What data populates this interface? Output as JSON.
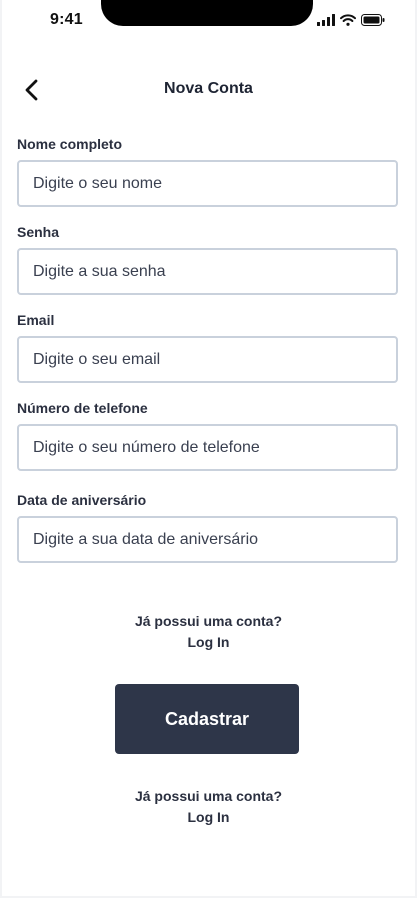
{
  "status_bar": {
    "time": "9:41",
    "icons": [
      "signal-icon",
      "wifi-icon",
      "battery-icon"
    ]
  },
  "header": {
    "back_icon": "chevron-left-icon",
    "title": "Nova Conta"
  },
  "form": {
    "fields": [
      {
        "label": "Nome completo",
        "placeholder": "Digite o seu nome",
        "value": ""
      },
      {
        "label": "Senha",
        "placeholder": "Digite a sua senha",
        "value": ""
      },
      {
        "label": "Email",
        "placeholder": "Digite o seu email",
        "value": ""
      },
      {
        "label": "Número de telefone",
        "placeholder": "Digite o seu número de telefone",
        "value": ""
      },
      {
        "label": "Data de aniversário",
        "placeholder": "Digite a sua data de aniversário",
        "value": ""
      }
    ]
  },
  "login_prompt_top": {
    "question": "Já possui uma conta?",
    "link": "Log In"
  },
  "submit": {
    "label": "Cadastrar"
  },
  "login_prompt_bottom": {
    "question": "Já possui uma conta?",
    "link": "Log In"
  },
  "colors": {
    "primary_button": "#2e3649",
    "input_border": "#c9d1dc",
    "text": "#2b3040"
  }
}
